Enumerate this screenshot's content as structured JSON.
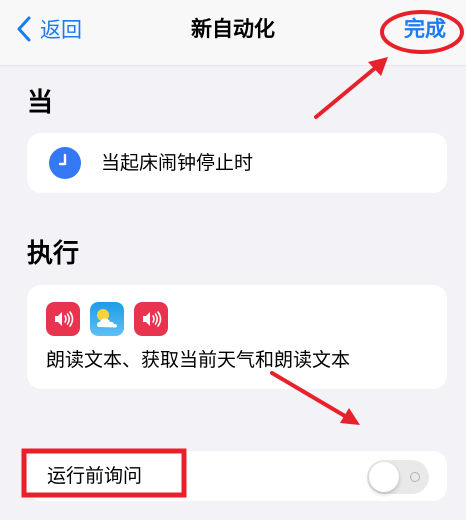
{
  "nav": {
    "back_label": "返回",
    "title": "新自动化",
    "done_label": "完成"
  },
  "when": {
    "heading": "当",
    "trigger_label": "当起床闹钟停止时",
    "icon": "clock-icon"
  },
  "do": {
    "heading": "执行",
    "app_icons": [
      "speaker-icon",
      "weather-icon",
      "speaker-icon"
    ],
    "summary": "朗读文本、获取当前天气和朗读文本"
  },
  "ask": {
    "label": "运行前询问",
    "toggle_on": false
  },
  "colors": {
    "accent": "#1a7cf2",
    "annotation": "#e8202a",
    "speaker_bg": "#e8344e",
    "weather_bg": "#1e9be8"
  }
}
